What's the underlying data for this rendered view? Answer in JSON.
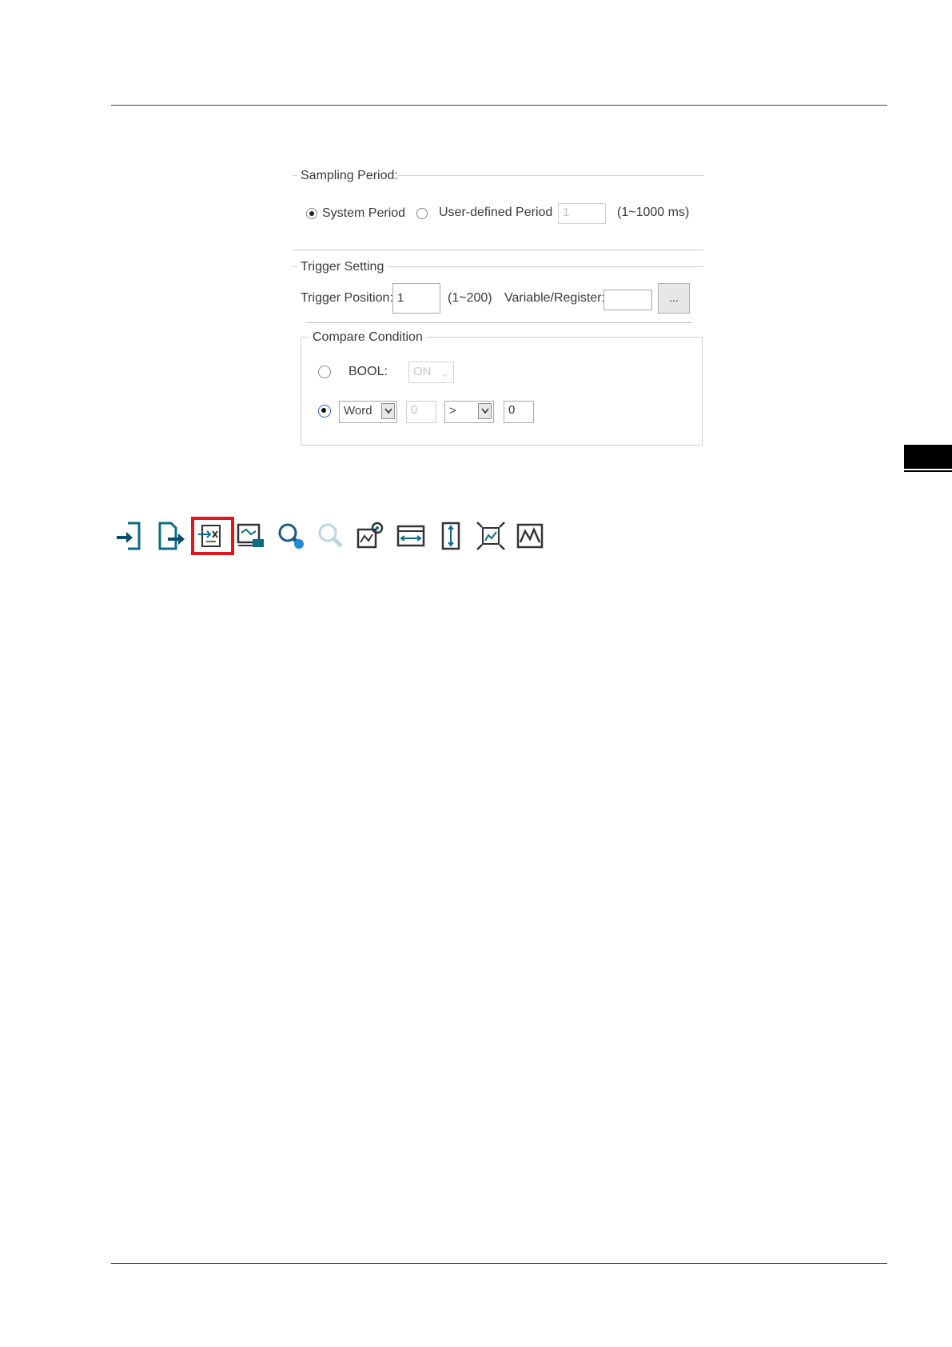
{
  "sampling": {
    "group_title": "Sampling Period:",
    "system_period_label": "System Period",
    "user_period_label": "User-defined Period",
    "user_period_value": "1",
    "user_period_range": "(1~1000 ms)",
    "selected": "System Period"
  },
  "trigger": {
    "group_title": "Trigger Setting",
    "position_label": "Trigger Position:",
    "position_value": "1",
    "position_range": "(1~200)",
    "variable_label": "Variable/Register:",
    "variable_value": "",
    "browse_button": "..."
  },
  "compare": {
    "group_title": "Compare Condition",
    "bool_label": "BOOL:",
    "bool_value": "ON",
    "type_value": "Word",
    "operand_value": "0",
    "operator_value": ">",
    "compare_value": "0",
    "selected": "Word"
  },
  "toolbar": {
    "icons": [
      "import-icon",
      "export-icon",
      "trigger-setting-icon",
      "screen-capture-icon",
      "zoom-in-icon",
      "zoom-out-icon",
      "chart-settings-icon",
      "fit-horizontal-icon",
      "fit-vertical-icon",
      "fit-all-icon",
      "waveform-icon"
    ],
    "highlighted": "trigger-setting-icon",
    "highlight_color": "#e3141e",
    "icon_color": "#0a6e86"
  }
}
